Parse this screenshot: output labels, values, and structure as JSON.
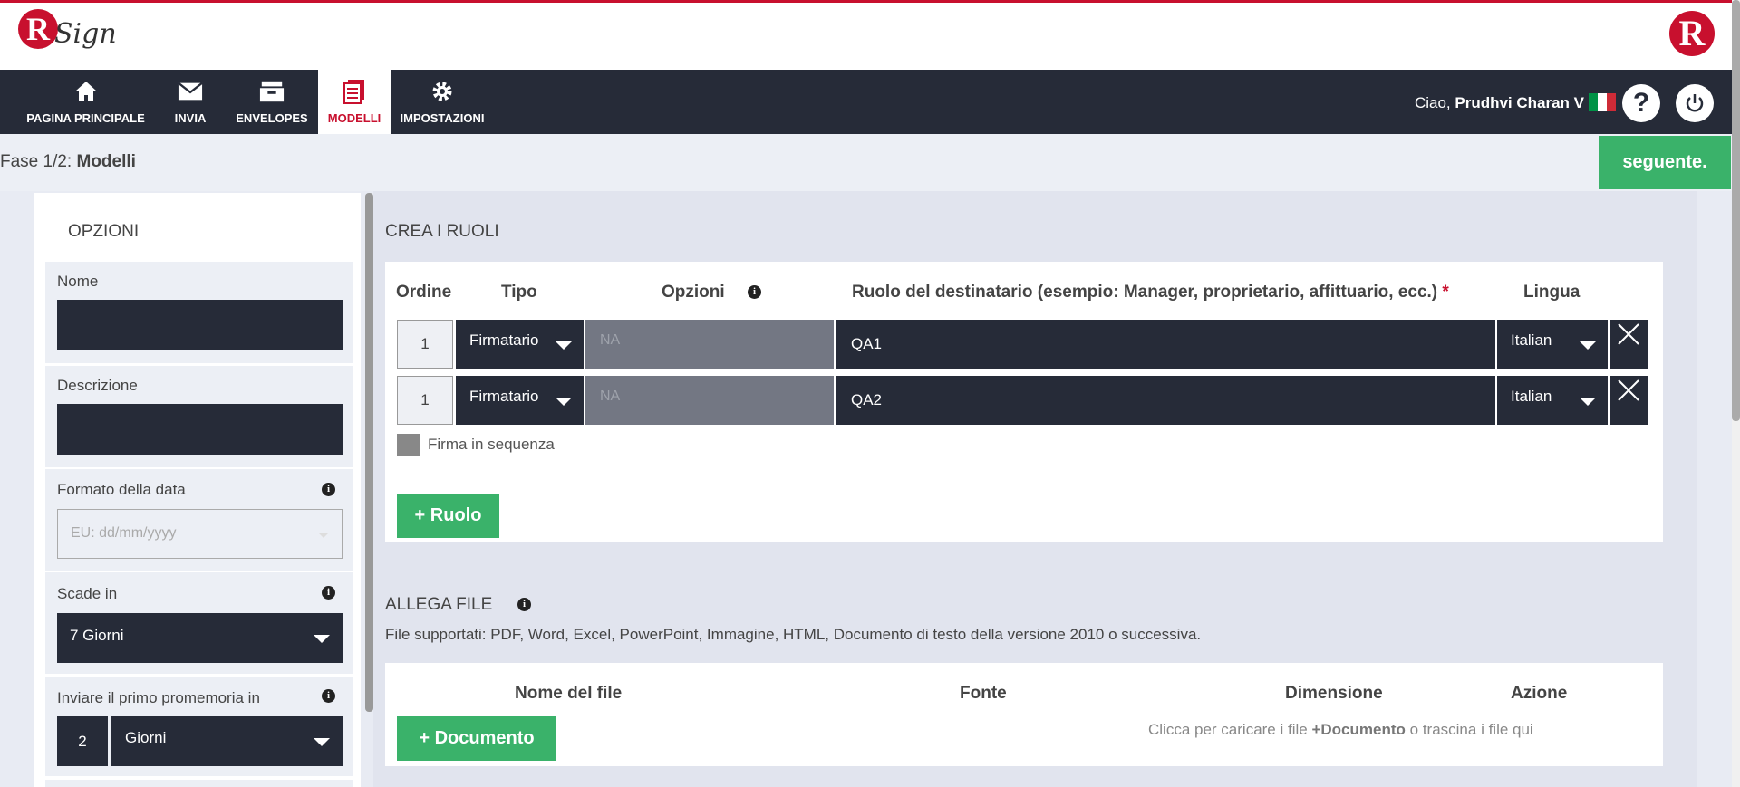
{
  "brand": {
    "logo_letter": "R",
    "logo_word": "Sign"
  },
  "nav": {
    "items": [
      {
        "label": "PAGINA PRINCIPALE",
        "icon": "home-icon"
      },
      {
        "label": "INVIA",
        "icon": "envelope-icon"
      },
      {
        "label": "ENVELOPES",
        "icon": "archive-icon"
      },
      {
        "label": "MODELLI",
        "icon": "document-icon",
        "active": true
      },
      {
        "label": "IMPOSTAZIONI",
        "icon": "gear-icon"
      }
    ],
    "greeting": "Ciao,",
    "user_name": "Prudhvi Charan V",
    "help_label": "?"
  },
  "step": {
    "prefix": "Fase 1/2:",
    "name": "Modelli",
    "next_label": "seguente."
  },
  "options": {
    "title": "OPZIONI",
    "name_label": "Nome",
    "name_value": "",
    "description_label": "Descrizione",
    "description_value": "",
    "date_format_label": "Formato della data",
    "date_format_placeholder": "EU: dd/mm/yyyy",
    "expires_label": "Scade in",
    "expires_value": "7 Giorni",
    "reminder_label": "Inviare il primo promemoria in",
    "reminder_count": "2",
    "reminder_unit": "Giorni"
  },
  "roles": {
    "title": "CREA I RUOLI",
    "headers": {
      "order": "Ordine",
      "type": "Tipo",
      "options": "Opzioni",
      "role": "Ruolo del destinatario (esempio: Manager, proprietario, affittuario, ecc.)",
      "required_mark": "*",
      "language": "Lingua"
    },
    "rows": [
      {
        "order": "1",
        "type": "Firmatario",
        "options": "NA",
        "role": "QA1",
        "language": "Italian"
      },
      {
        "order": "1",
        "type": "Firmatario",
        "options": "NA",
        "role": "QA2",
        "language": "Italian"
      }
    ],
    "sequence_label": "Firma in sequenza",
    "add_role_label": "+ Ruolo"
  },
  "attach": {
    "title": "ALLEGA FILE",
    "supported": "File supportati: PDF, Word, Excel, PowerPoint, Immagine, HTML, Documento di testo della versione 2010 o successiva.",
    "headers": {
      "file_name": "Nome del file",
      "source": "Fonte",
      "size": "Dimensione",
      "action": "Azione"
    },
    "add_document_label": "+ Documento",
    "drop_prefix": "Clicca per caricare i file",
    "drop_bold": "+Documento",
    "drop_suffix": "o trascina i file qui"
  },
  "colors": {
    "accent_red": "#c8102e",
    "nav_dark": "#262b38",
    "green": "#3ab26a"
  }
}
